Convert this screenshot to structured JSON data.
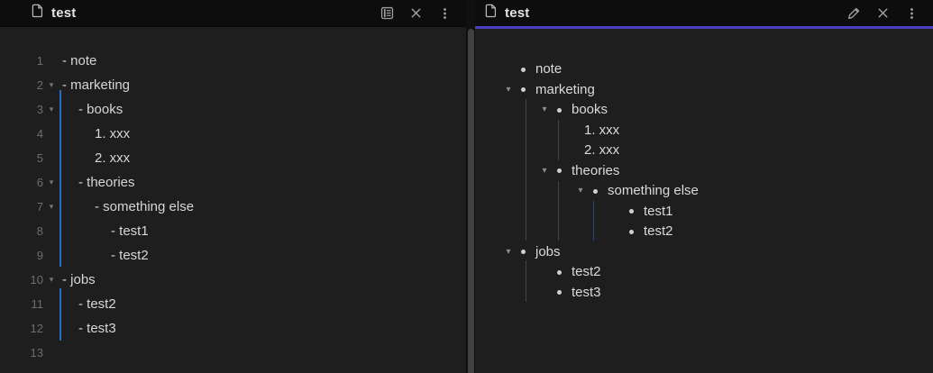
{
  "colors": {
    "accent_active_tab_underline": "#4a3ec1",
    "editor_active_indent_guide": "#2a6cbe",
    "preview_indent_guide": "#2c4a66",
    "pane_background": "#1e1e1e",
    "header_background": "#0d0d0d"
  },
  "editor": {
    "tab_title": "test",
    "header_icons": [
      "file-icon",
      "reading-view-icon",
      "close-icon",
      "more-vertical-icon"
    ],
    "lines": [
      {
        "number": 1,
        "fold": false,
        "indent": 0,
        "marker": "-",
        "text": "note"
      },
      {
        "number": 2,
        "fold": true,
        "indent": 0,
        "marker": "-",
        "text": "marketing"
      },
      {
        "number": 3,
        "fold": true,
        "indent": 1,
        "marker": "-",
        "text": "books"
      },
      {
        "number": 4,
        "fold": false,
        "indent": 2,
        "marker": "1.",
        "text": "xxx"
      },
      {
        "number": 5,
        "fold": false,
        "indent": 2,
        "marker": "2.",
        "text": "xxx"
      },
      {
        "number": 6,
        "fold": true,
        "indent": 1,
        "marker": "-",
        "text": "theories"
      },
      {
        "number": 7,
        "fold": true,
        "indent": 2,
        "marker": "-",
        "text": "something else"
      },
      {
        "number": 8,
        "fold": false,
        "indent": 3,
        "marker": "-",
        "text": "test1"
      },
      {
        "number": 9,
        "fold": false,
        "indent": 3,
        "marker": "-",
        "text": "test2"
      },
      {
        "number": 10,
        "fold": true,
        "indent": 0,
        "marker": "-",
        "text": "jobs"
      },
      {
        "number": 11,
        "fold": false,
        "indent": 1,
        "marker": "-",
        "text": "test2"
      },
      {
        "number": 12,
        "fold": false,
        "indent": 1,
        "marker": "-",
        "text": "test3"
      },
      {
        "number": 13,
        "fold": false,
        "indent": 0,
        "marker": "",
        "text": ""
      }
    ]
  },
  "preview": {
    "tab_title": "test",
    "header_icons": [
      "file-icon",
      "edit-icon",
      "close-icon",
      "more-vertical-icon"
    ],
    "rows": [
      {
        "indent": 0,
        "collapsible": false,
        "type": "bullet",
        "marker": "",
        "text": "note"
      },
      {
        "indent": 0,
        "collapsible": true,
        "type": "bullet",
        "marker": "",
        "text": "marketing"
      },
      {
        "indent": 1,
        "collapsible": true,
        "type": "bullet",
        "marker": "",
        "text": "books"
      },
      {
        "indent": 2,
        "collapsible": false,
        "type": "ordered",
        "marker": "1.",
        "text": "xxx"
      },
      {
        "indent": 2,
        "collapsible": false,
        "type": "ordered",
        "marker": "2.",
        "text": "xxx"
      },
      {
        "indent": 1,
        "collapsible": true,
        "type": "bullet",
        "marker": "",
        "text": "theories"
      },
      {
        "indent": 2,
        "collapsible": true,
        "type": "bullet",
        "marker": "",
        "text": "something else"
      },
      {
        "indent": 3,
        "collapsible": false,
        "type": "bullet",
        "marker": "",
        "text": "test1"
      },
      {
        "indent": 3,
        "collapsible": false,
        "type": "bullet",
        "marker": "",
        "text": "test2"
      },
      {
        "indent": 0,
        "collapsible": true,
        "type": "bullet",
        "marker": "",
        "text": "jobs"
      },
      {
        "indent": 1,
        "collapsible": false,
        "type": "bullet",
        "marker": "",
        "text": "test2"
      },
      {
        "indent": 1,
        "collapsible": false,
        "type": "bullet",
        "marker": "",
        "text": "test3"
      }
    ]
  }
}
